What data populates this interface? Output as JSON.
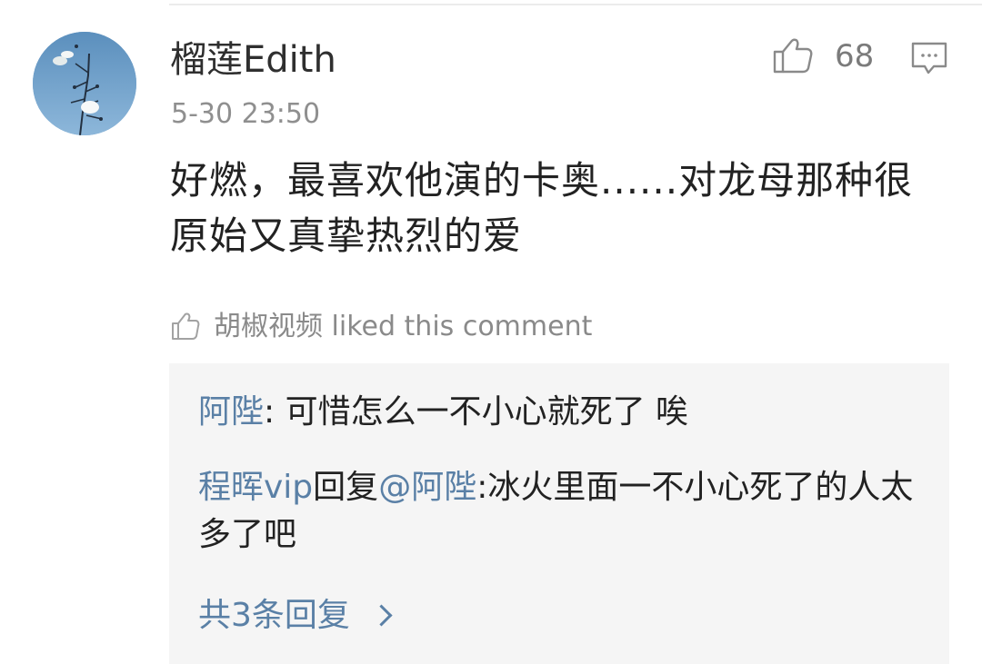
{
  "comment": {
    "username": "榴莲Edith",
    "timestamp": "5-30 23:50",
    "like_count": "68",
    "body": "好燃，最喜欢他演的卡奥......对龙母那种很原始又真挚热烈的爱",
    "avatar_icon": "avatar-sky-branch",
    "like_icon": "thumbs-up-icon",
    "reply_icon": "comment-bubble-icon"
  },
  "liked_by": {
    "icon": "thumbs-up-icon",
    "text": "胡椒视频 liked this comment"
  },
  "replies": [
    {
      "author": "阿陛",
      "separator": ": ",
      "text": "可惜怎么一不小心就死了 唉"
    },
    {
      "author": "程晖vip",
      "verb": "回复",
      "mention": "@阿陛",
      "separator": ":",
      "text": "冰火里面一不小心死了的人太多了吧"
    }
  ],
  "view_all_replies": {
    "label": "共3条回复",
    "icon": "chevron-right-icon"
  },
  "colors": {
    "link": "#5a80a6",
    "text": "#222222",
    "meta": "#8f8f8f",
    "reply_background": "#f5f5f5"
  }
}
